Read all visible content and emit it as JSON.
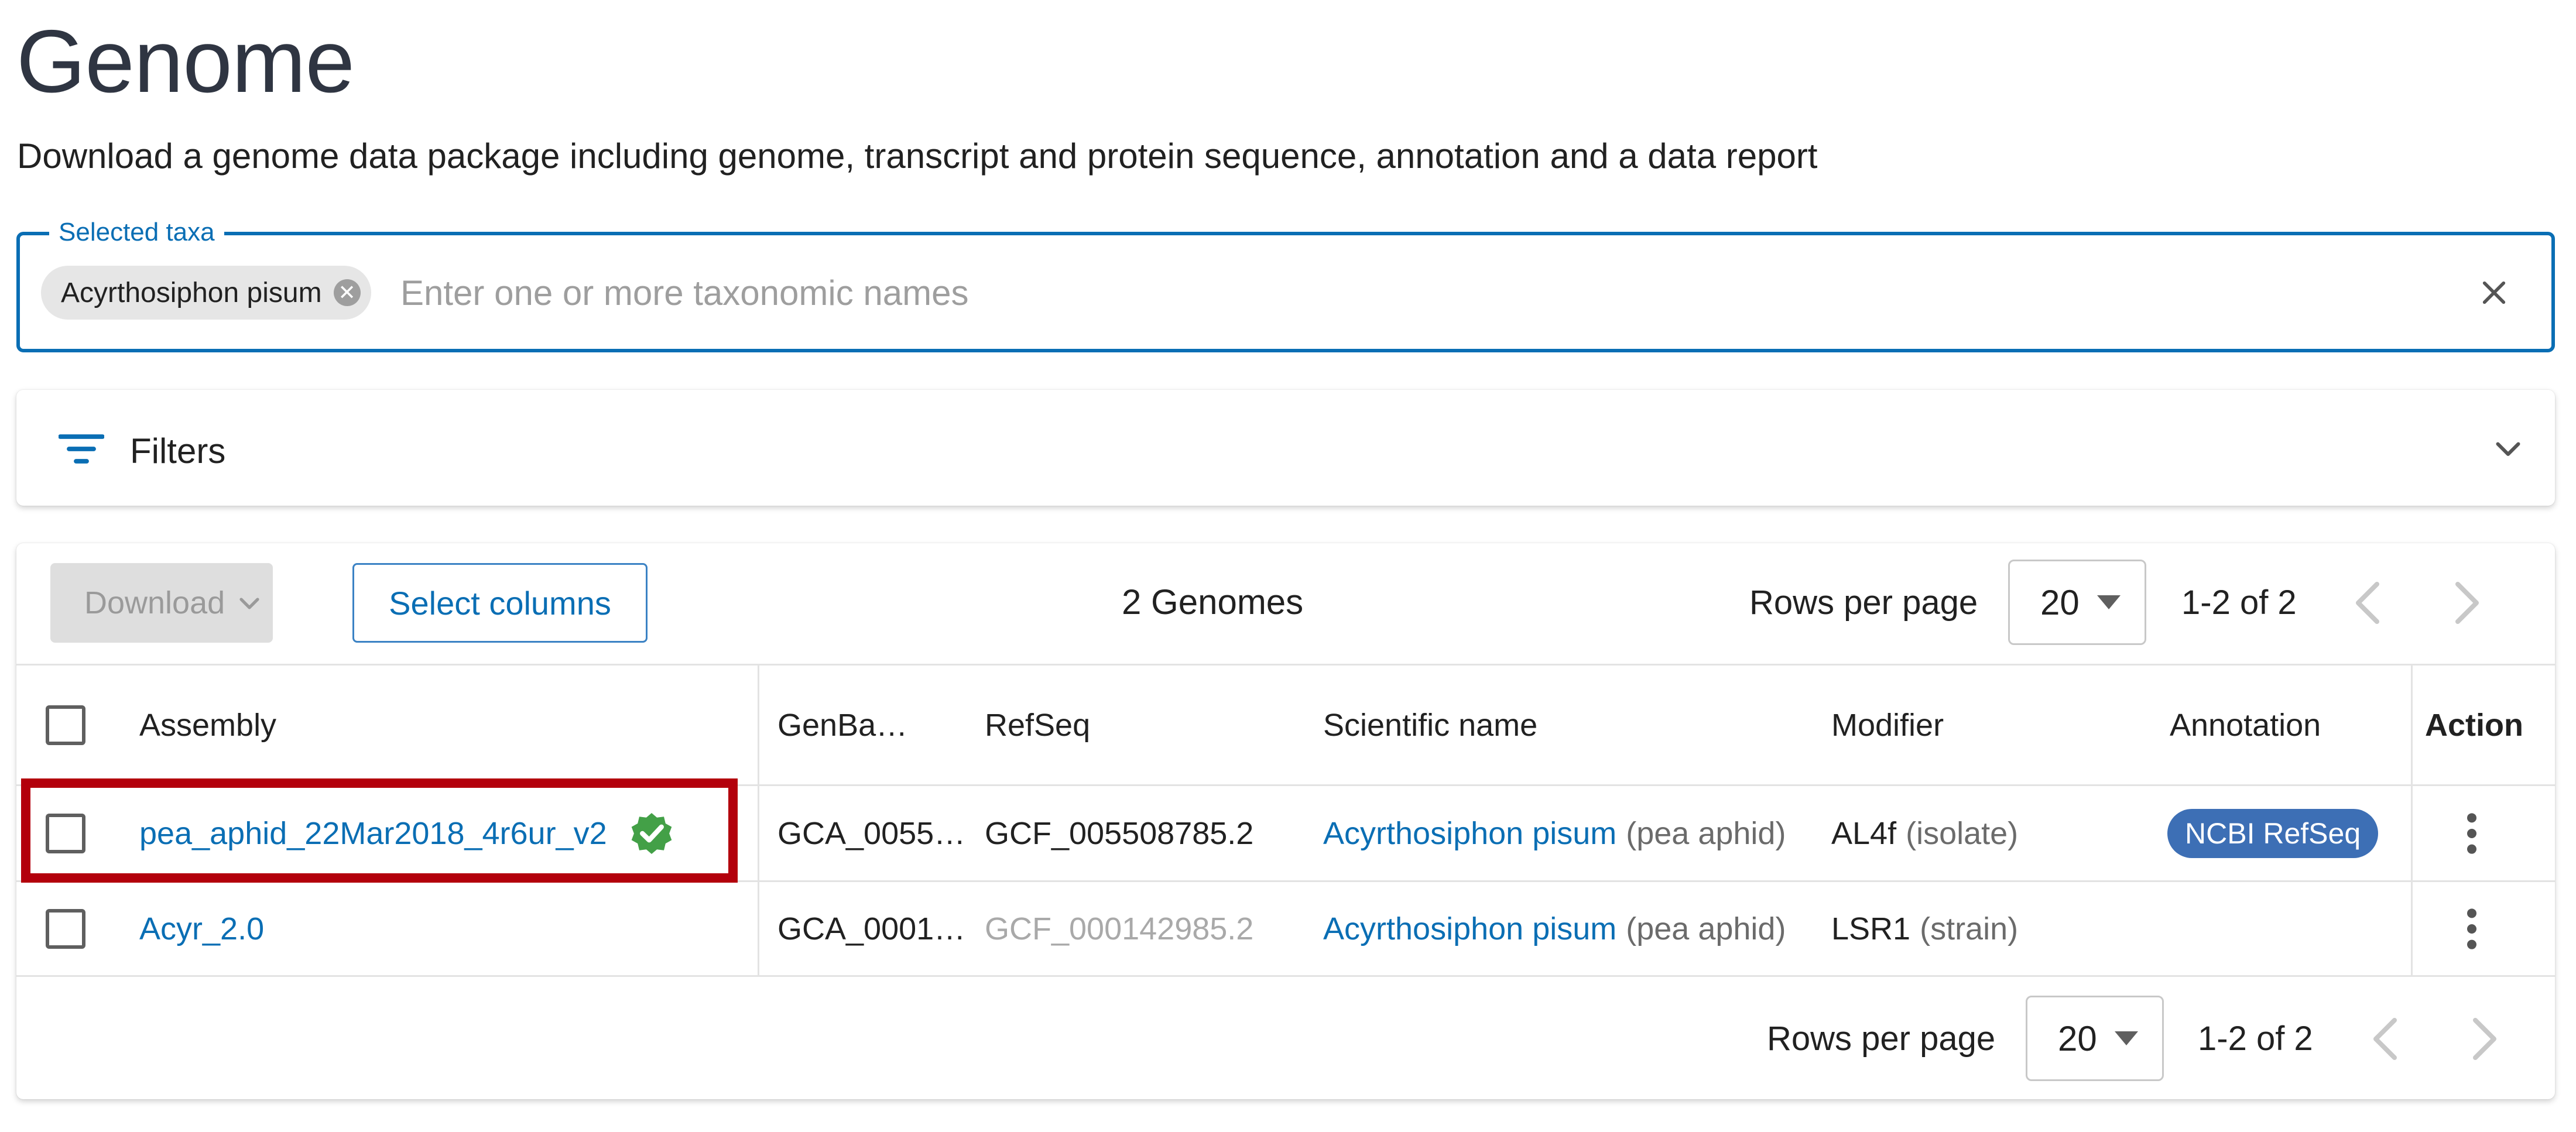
{
  "header": {
    "title": "Genome",
    "subtitle": "Download a genome data package including genome, transcript and protein sequence, annotation and a data report"
  },
  "taxa": {
    "legend": "Selected taxa",
    "chip_label": "Acyrthosiphon pisum",
    "placeholder": "Enter one or more taxonomic names"
  },
  "filters": {
    "label": "Filters"
  },
  "toolbar": {
    "download_label": "Download",
    "select_columns_label": "Select columns",
    "count_text": "2 Genomes",
    "rows_per_page_label": "Rows per page",
    "rows_per_page_value": "20",
    "range_text": "1-2 of 2"
  },
  "table": {
    "columns": [
      "Assembly",
      "GenBa…",
      "RefSeq",
      "Scientific name",
      "Modifier",
      "Annotation",
      "Action"
    ],
    "rows": [
      {
        "assembly": "pea_aphid_22Mar2018_4r6ur_v2",
        "verified": true,
        "genbank": "GCA_0055…",
        "refseq": "GCF_005508785.2",
        "refseq_muted": false,
        "sci_name": "Acyrthosiphon pisum",
        "common_name": "(pea aphid)",
        "modifier": "AL4f",
        "modifier_type": "(isolate)",
        "annotation": "NCBI RefSeq"
      },
      {
        "assembly": "Acyr_2.0",
        "verified": false,
        "genbank": "GCA_0001…",
        "refseq": "GCF_000142985.2",
        "refseq_muted": true,
        "sci_name": "Acyrthosiphon pisum",
        "common_name": "(pea aphid)",
        "modifier": "LSR1",
        "modifier_type": "(strain)",
        "annotation": ""
      }
    ]
  },
  "footer": {
    "rows_per_page_label": "Rows per page",
    "rows_per_page_value": "20",
    "range_text": "1-2 of 2"
  },
  "colors": {
    "accent": "#0a6eb4",
    "badge": "#3d6fb5",
    "highlight": "#b3000c",
    "verified": "#43a047"
  }
}
